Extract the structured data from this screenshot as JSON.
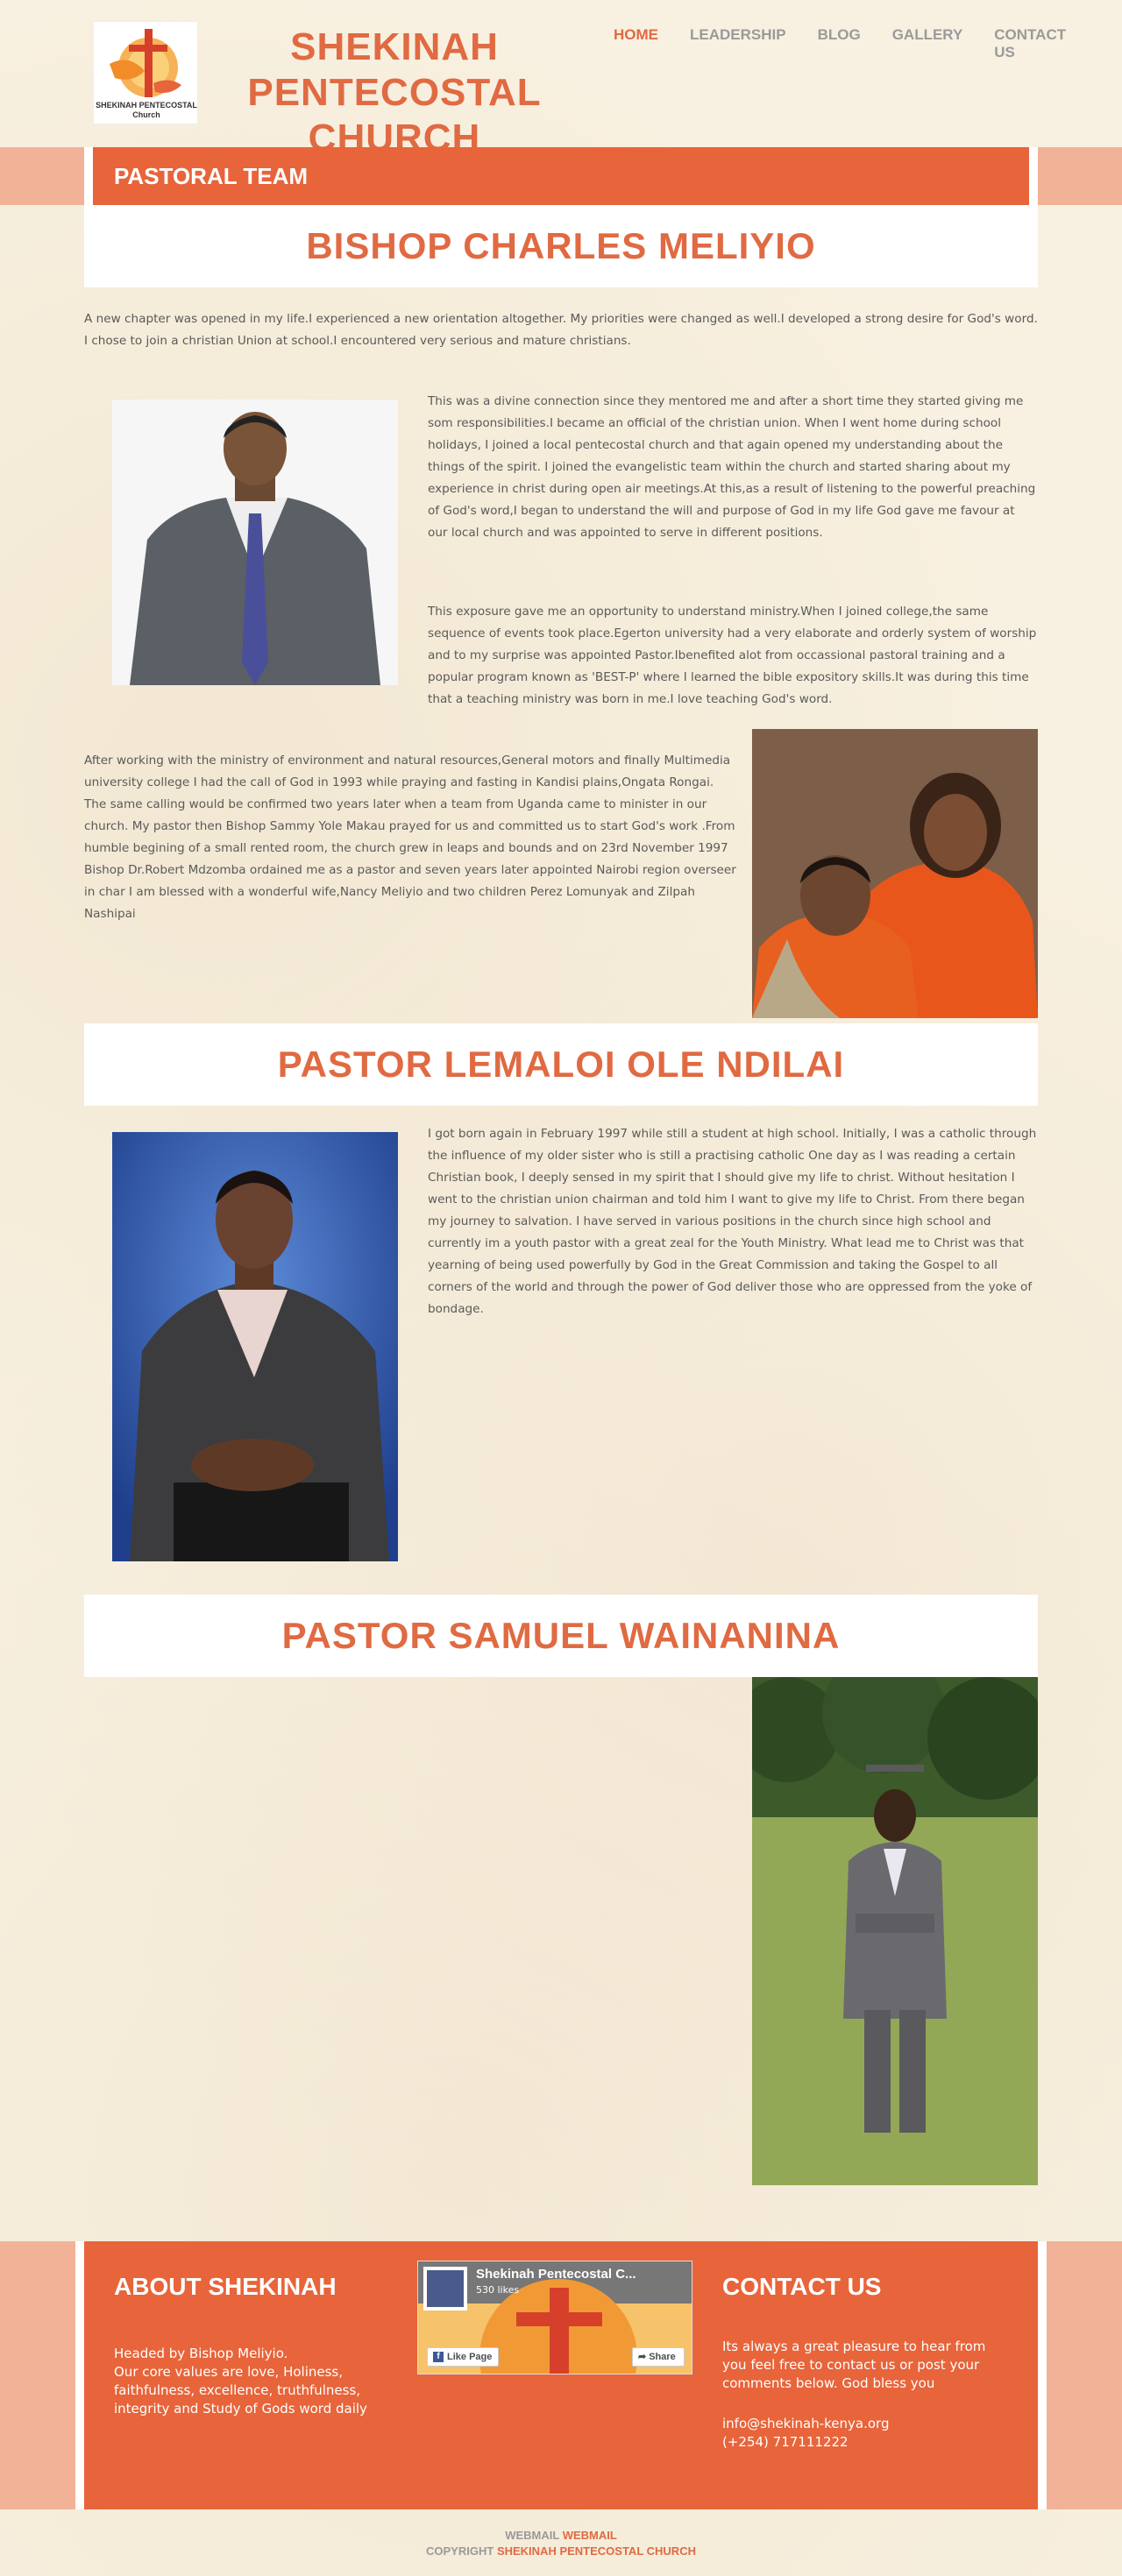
{
  "header": {
    "logo_text": "SHEKINAH PENTECOSTAL Church",
    "site_title_line1": "SHEKINAH PENTECOSTAL",
    "site_title_line2": "CHURCH",
    "nav": [
      {
        "label": "HOME",
        "active": true
      },
      {
        "label": "LEADERSHIP",
        "active": false
      },
      {
        "label": "BLOG",
        "active": false
      },
      {
        "label": "GALLERY",
        "active": false
      },
      {
        "label": "CONTACT US",
        "active": false
      }
    ]
  },
  "section_title": "PASTORAL TEAM",
  "pastors": [
    {
      "name": "BISHOP CHARLES MELIYIO",
      "intro": "A new chapter was opened in my life.I experienced a new orientation altogether. My priorities were changed as well.I developed a strong desire for God's word. I chose to join a christian Union at school.I encountered very serious and mature christians.",
      "para1": "This was a divine connection since they mentored me and after a short time they started giving me som responsibilities.I became an official of the christian union. When I went home during school holidays, I joined a local pentecostal church and that again opened my understanding about the things of the spirit. I joined the evangelistic team within the church and started sharing about my experience in christ during open air meetings.At this,as a result of listening to the powerful preaching of God's word,I began to understand the will and purpose of God in my life God gave me favour at our local church and was appointed to serve in different positions.",
      "para2": "This exposure gave me an opportunity to understand ministry.When I joined college,the same sequence of events took place.Egerton university had a very elaborate and orderly system of worship and to my surprise was appointed Pastor.Ibenefited alot from occassional pastoral training and a popular program known as 'BEST-P' where I learned the bible expository skills.It was during this time that a teaching ministry was born in me.I love teaching God's word.",
      "para3": "After working with the ministry of environment and natural resources,General motors and finally Multimedia university college I had the call of God in 1993 while praying and fasting in Kandisi plains,Ongata Rongai. The same calling would be confirmed two years later when a team from Uganda came to minister in our church. My pastor then Bishop Sammy Yole Makau prayed for us and committed us to start God's work .From humble begining of a small rented room, the church grew in leaps and bounds and on 23rd November 1997 Bishop Dr.Robert Mdzomba ordained me as a pastor and seven years later appointed Nairobi region overseer in char I am blessed with a wonderful wife,Nancy Meliyio and two children Perez Lomunyak and Zilpah Nashipai"
    },
    {
      "name": "PASTOR LEMALOI OLE NDILAI",
      "para1": "I got born again in February 1997 while still a student at high school. Initially, I was a catholic through the influence of my older sister who is still a practising catholic One day as I was reading a certain Christian book, I deeply sensed in my spirit that I should give my life to christ. Without hesitation I went to the christian union chairman and told him I want to give my life to Christ. From there began my journey to salvation. I have served in various positions in the church since high school and currently im a youth pastor with a great zeal for the Youth Ministry. What lead me to Christ was that yearning of being used powerfully by God in the Great Commission and taking the Gospel to all corners of the world and through the power of God deliver those who are oppressed from the yoke of bondage."
    },
    {
      "name": "PASTOR SAMUEL WAINANINA"
    }
  ],
  "footer": {
    "about_title": "ABOUT SHEKINAH",
    "about_text": "Headed by Bishop Meliyio.\nOur core values are love, Holiness, faithfulness, excellence, truthfulness, integrity and Study of Gods word daily",
    "fb_page_name": "Shekinah Pentecostal C...",
    "fb_likes": "530 likes",
    "fb_like_label": "Like Page",
    "fb_share_label": "Share",
    "contact_title": "CONTACT US",
    "contact_text": "Its always a great pleasure to hear from you feel free to contact us or post your comments below. God bless you",
    "email": "info@shekinah-kenya.org",
    "phone": "(+254) 717111222"
  },
  "bottom": {
    "webmail_prefix": "WEBMAIL",
    "webmail_link": "WEBMAIL",
    "copyright_prefix": "COPYRIGHT",
    "copyright_link": "SHEKINAH PENTECOSTAL CHURCH"
  },
  "colors": {
    "accent": "#e8643a",
    "accent_light": "#f2b298",
    "background": "#f8f0e0"
  }
}
